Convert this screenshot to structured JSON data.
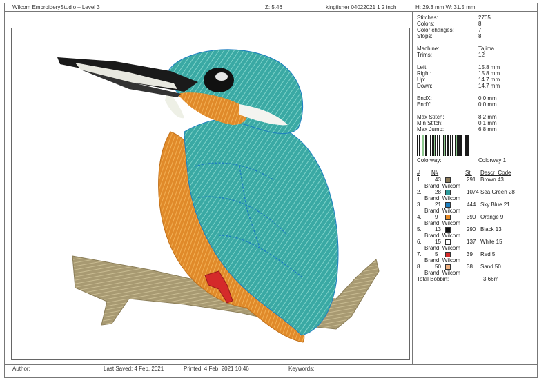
{
  "header": {
    "app_title": "Wilcom EmbroideryStudio – Level 3",
    "zoom": "Z: 5.46",
    "file_name": "kingfisher 04022021 1  2 inch",
    "dimensions": "H: 29.3 mm   W: 31.5 mm"
  },
  "stats": [
    {
      "label": "Stitches:",
      "value": "2705"
    },
    {
      "label": "Colors:",
      "value": "8"
    },
    {
      "label": "Color changes:",
      "value": "7"
    },
    {
      "label": "Stops:",
      "value": "8"
    },
    {
      "label": "",
      "value": ""
    },
    {
      "label": "Machine:",
      "value": "Tajima"
    },
    {
      "label": "Trims:",
      "value": "12"
    },
    {
      "label": "",
      "value": ""
    },
    {
      "label": "Left:",
      "value": "15.8 mm"
    },
    {
      "label": "Right:",
      "value": "15.8 mm"
    },
    {
      "label": "Up:",
      "value": "14.7 mm"
    },
    {
      "label": "Down:",
      "value": "14.7 mm"
    },
    {
      "label": "",
      "value": ""
    },
    {
      "label": "EndX:",
      "value": "0.0 mm"
    },
    {
      "label": "EndY:",
      "value": "0.0 mm"
    },
    {
      "label": "",
      "value": ""
    },
    {
      "label": "Max Stitch:",
      "value": "8.2 mm"
    },
    {
      "label": "Min Stitch:",
      "value": "0.1 mm"
    },
    {
      "label": "Max Jump:",
      "value": "6.8 mm"
    }
  ],
  "colorway": {
    "label": "Colorway:",
    "value": "Colorway 1"
  },
  "color_table": {
    "headers": {
      "num": "#",
      "n": "N#",
      "st": "St.",
      "descr": "Descr_Code"
    },
    "rows": [
      {
        "idx": "1.",
        "n": "43",
        "color": "#8a7a5a",
        "st": "291",
        "descr": "Brown 43",
        "brand": "Brand: Wilcom"
      },
      {
        "idx": "2.",
        "n": "28",
        "color": "#2e9a9a",
        "st": "1074",
        "descr": "Sea Green 28",
        "brand": "Brand: Wilcom"
      },
      {
        "idx": "3.",
        "n": "21",
        "color": "#1e7fc0",
        "st": "444",
        "descr": "Sky Blue 21",
        "brand": "Brand: Wilcom"
      },
      {
        "idx": "4.",
        "n": "9",
        "color": "#e88a25",
        "st": "390",
        "descr": "Orange 9",
        "brand": "Brand: Wilcom"
      },
      {
        "idx": "5.",
        "n": "13",
        "color": "#111111",
        "st": "290",
        "descr": "Black 13",
        "brand": "Brand: Wilcom"
      },
      {
        "idx": "6.",
        "n": "15",
        "color": "#ffffff",
        "st": "137",
        "descr": "White 15",
        "brand": "Brand: Wilcom"
      },
      {
        "idx": "7.",
        "n": "5",
        "color": "#d42a2a",
        "st": "39",
        "descr": "Red 5",
        "brand": "Brand: Wilcom"
      },
      {
        "idx": "8.",
        "n": "50",
        "color": "#f0b080",
        "st": "38",
        "descr": "Sand 50",
        "brand": "Brand: Wilcom"
      }
    ],
    "total_bobbin_label": "Total Bobbin:",
    "total_bobbin_value": "3.66m"
  },
  "footer": {
    "author": "Author:",
    "last_saved": "Last Saved:  4 Feb, 2021",
    "printed": "Printed:  4 Feb, 2021 10:46",
    "keywords": "Keywords:"
  }
}
